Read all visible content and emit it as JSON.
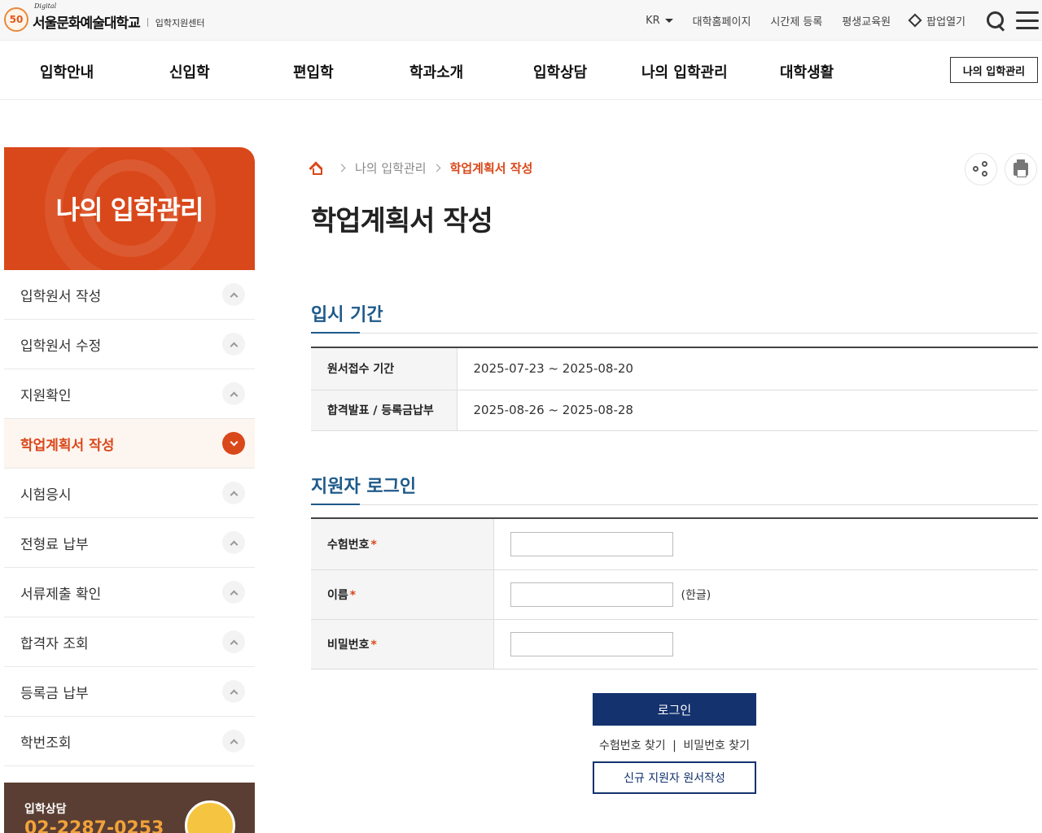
{
  "header": {
    "logo_badge": "50",
    "logo_digital": "Digital",
    "logo_name": "서울문화예술대학교",
    "logo_sub": "입학지원센터",
    "util": {
      "lang": "KR",
      "univ_home": "대학홈페이지",
      "timed_reg": "시간제 등록",
      "lifelong": "평생교육원",
      "popup": "팝업열기"
    }
  },
  "gnb": {
    "items": [
      "입학안내",
      "신입학",
      "편입학",
      "학과소개",
      "입학상담",
      "나의 입학관리",
      "대학생활"
    ],
    "my_button": "나의 입학관리"
  },
  "sidebar": {
    "title": "나의 입학관리",
    "items": [
      {
        "label": "입학원서 작성"
      },
      {
        "label": "입학원서 수정"
      },
      {
        "label": "지원확인"
      },
      {
        "label": "학업계획서 작성",
        "active": true
      },
      {
        "label": "시험응시"
      },
      {
        "label": "전형료 납부"
      },
      {
        "label": "서류제출 확인"
      },
      {
        "label": "합격자 조회"
      },
      {
        "label": "등록금 납부"
      },
      {
        "label": "학번조회"
      }
    ],
    "consult": {
      "label": "입학상담",
      "phone": "02-2287-0253"
    }
  },
  "breadcrumb": {
    "level1": "나의 입학관리",
    "current": "학업계획서 작성"
  },
  "page_title": "학업계획서 작성",
  "period_section": {
    "title": "입시 기간",
    "rows": [
      {
        "label": "원서접수 기간",
        "value": "2025-07-23 ~ 2025-08-20"
      },
      {
        "label": "합격발표 / 등록금납부",
        "value": "2025-08-26 ~ 2025-08-28"
      }
    ]
  },
  "login_section": {
    "title": "지원자 로그인",
    "fields": [
      {
        "label": "수험번호",
        "required": "*",
        "hint": ""
      },
      {
        "label": "이름",
        "required": "*",
        "hint": "(한글)"
      },
      {
        "label": "비밀번호",
        "required": "*",
        "hint": ""
      }
    ],
    "login_button": "로그인",
    "find_id": "수험번호 찾기",
    "find_sep": "|",
    "find_pw": "비밀번호 찾기",
    "new_button": "신규 지원자 원서작성"
  },
  "colors": {
    "brand_orange": "#d9481a",
    "navy": "#14326e",
    "section_blue": "#1e5a8a"
  }
}
